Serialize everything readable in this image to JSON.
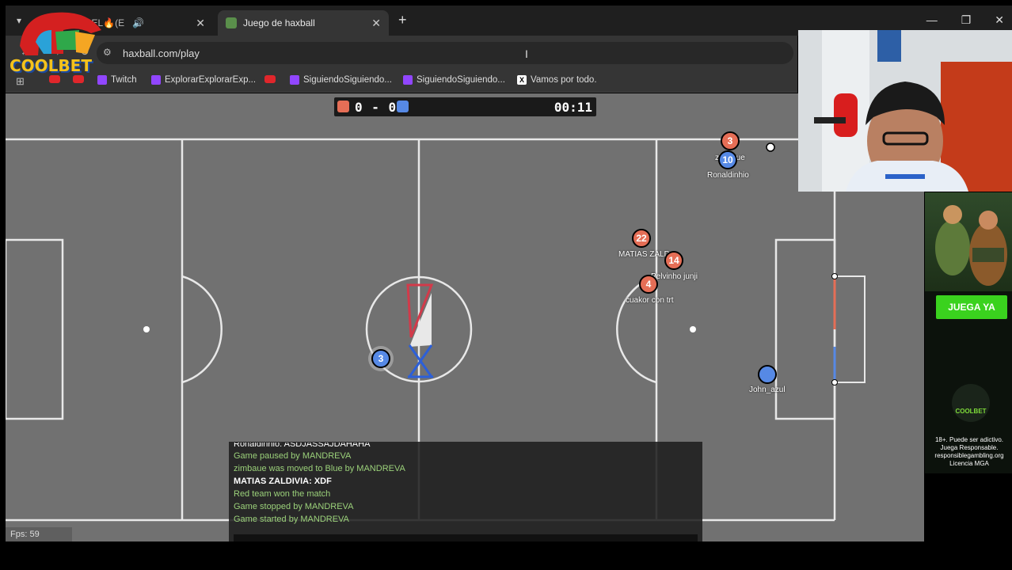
{
  "browser": {
    "tabs": [
      {
        "label": "IN Y YANDEL🔥(E",
        "active": false
      },
      {
        "label": "Juego de haxball",
        "active": true
      }
    ],
    "url": "haxball.com/play",
    "bookmarks": [
      {
        "label": "",
        "icon": "youtube-icon"
      },
      {
        "label": "",
        "icon": "youtube-icon"
      },
      {
        "label": "Twitch",
        "icon": "twitch-icon"
      },
      {
        "label": "ExplorarExplorarExp...",
        "icon": "twitch-icon"
      },
      {
        "label": "",
        "icon": "youtube-icon"
      },
      {
        "label": "SiguiendoSiguiendo...",
        "icon": "twitch-icon"
      },
      {
        "label": "SiguiendoSiguiendo...",
        "icon": "twitch-icon"
      },
      {
        "label": "Vamos por todo.",
        "icon": "x-icon"
      }
    ]
  },
  "scoreboard": {
    "score": "0 - 0",
    "time": "00:11",
    "red_color": "#e56e56",
    "blue_color": "#5689e5"
  },
  "players": [
    {
      "number": "3",
      "team": "red",
      "name": "zimbaue"
    },
    {
      "number": "10",
      "team": "blue",
      "name": "Ronaldinhio"
    },
    {
      "number": "22",
      "team": "red",
      "name": "MATIAS ZALD"
    },
    {
      "number": "14",
      "team": "red",
      "name": "Pelvinho junji"
    },
    {
      "number": "4",
      "team": "red",
      "name": "cuakor con trt"
    },
    {
      "number": "3",
      "team": "blue",
      "name": ""
    },
    {
      "number": "",
      "team": "blue",
      "name": "John_azul"
    }
  ],
  "chat": [
    {
      "text": "Ronaldinhio: ASDJASSAJDAHAHA",
      "type": "user"
    },
    {
      "text": "Game paused by MANDREVA",
      "type": "system"
    },
    {
      "text": "zimbaue was moved to Blue by MANDREVA",
      "type": "system"
    },
    {
      "text": "MATIAS ZALDIVIA: XDF",
      "type": "user"
    },
    {
      "text": "Red team won the match",
      "type": "system"
    },
    {
      "text": "Game stopped by MANDREVA",
      "type": "system"
    },
    {
      "text": "Game started by MANDREVA",
      "type": "system"
    }
  ],
  "fps": "Fps: 59",
  "overlay": {
    "logo_text": "COOLBET",
    "ad_button": "JUEGA YA",
    "ad_logo": "COOLBET",
    "ad_disclaimer": "18+. Puede ser adictivo. Juega Responsable. responsiblegambling.org Licencia MGA"
  }
}
